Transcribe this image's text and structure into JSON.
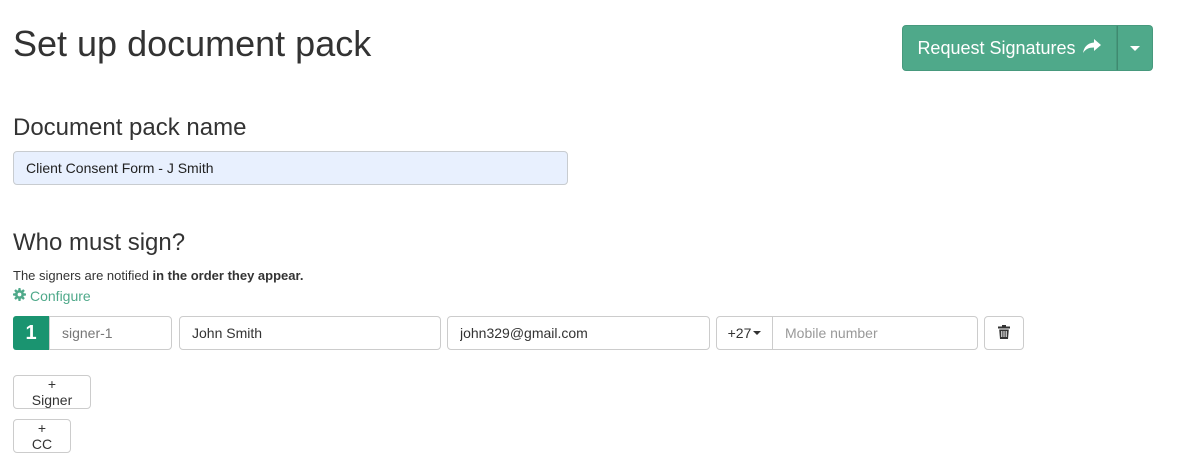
{
  "header": {
    "title": "Set up document pack",
    "request_button_label": "Request Signatures",
    "request_icon": "share-arrow-icon",
    "dropdown_icon": "caret-down-icon"
  },
  "pack": {
    "heading": "Document pack name",
    "name_value": "Client Consent Form - J Smith"
  },
  "signers_section": {
    "heading": "Who must sign?",
    "notice_prefix": "The signers are notified ",
    "notice_bold": "in the order they appear.",
    "configure_label": "Configure",
    "configure_icon": "gear-icon"
  },
  "signers": [
    {
      "order": "1",
      "role": "signer-1",
      "name": "John Smith",
      "email": "john329@gmail.com",
      "country_code": "+27",
      "mobile": "",
      "mobile_placeholder": "Mobile number",
      "delete_icon": "trash-icon"
    }
  ],
  "actions": {
    "add_signer_label": "+ Signer",
    "add_cc_label": "+ CC"
  },
  "colors": {
    "accent": "#4fa98a",
    "order_badge": "#1a9470",
    "input_autofill": "#e8f0fe"
  }
}
